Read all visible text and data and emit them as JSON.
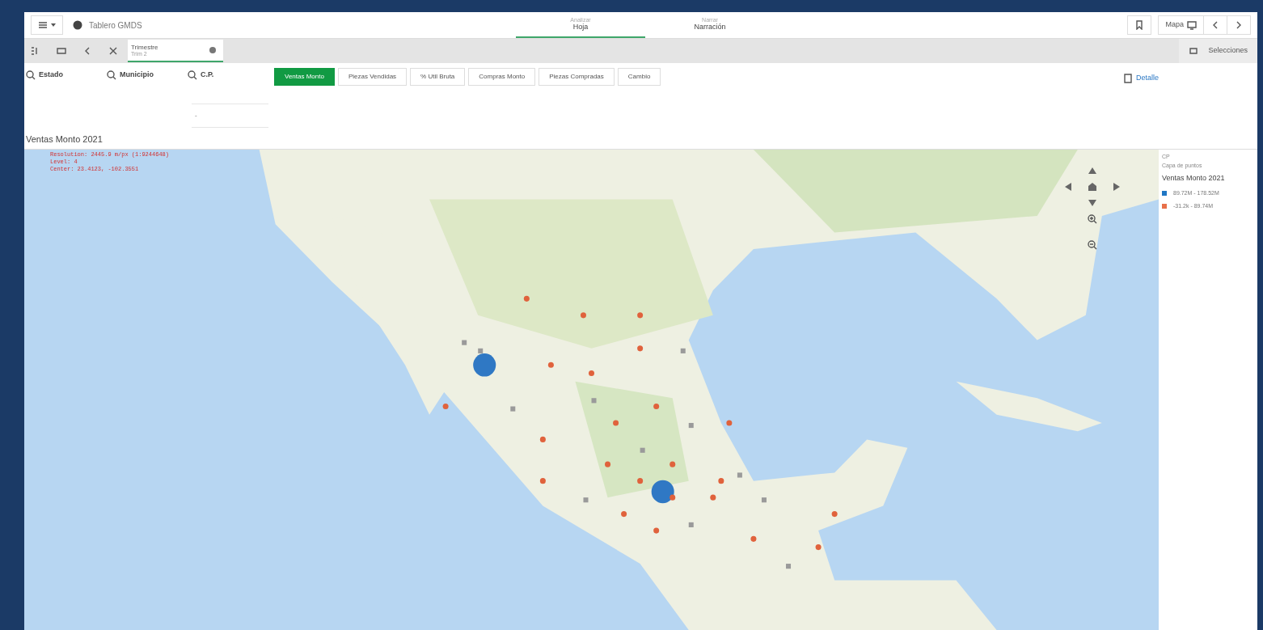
{
  "app_bar": {
    "app_name": "Tablero GMDS",
    "tabs": [
      {
        "caption": "Analizar",
        "label": "Hoja",
        "selected": true
      },
      {
        "caption": "Narrar",
        "label": "Narración",
        "selected": false
      }
    ],
    "sheet_selector": "Mapa"
  },
  "toolbar": {
    "selection": {
      "title": "Trimestre",
      "value": "Trim 2"
    },
    "selections_label": "Selecciones"
  },
  "filters": [
    "Estado",
    "Municipio",
    "C.P."
  ],
  "measures": [
    {
      "label": "Ventas Monto",
      "selected": true
    },
    {
      "label": "Piezas Vendidas",
      "selected": false
    },
    {
      "label": "% Util Bruta",
      "selected": false
    },
    {
      "label": "Compras Monto",
      "selected": false
    },
    {
      "label": "Piezas Compradas",
      "selected": false
    },
    {
      "label": "Cambio",
      "selected": false
    }
  ],
  "dropdown_value": "-",
  "detail_link": "Detalle",
  "chart_title": "Ventas Monto 2021",
  "map": {
    "debug": [
      "Resolution: 2445.9 m/px (1:9244648)",
      "Level: 4",
      "Center: 23.4123, -102.3551"
    ],
    "legend": {
      "layer": "CP",
      "layer_type": "Capa de puntos",
      "measure": "Ventas Monto 2021",
      "items": [
        {
          "label": "89.72M - 178.52M",
          "color": "#1f77c4"
        },
        {
          "label": "-31.2k - 89.74M",
          "color": "#e8704a"
        }
      ]
    }
  }
}
